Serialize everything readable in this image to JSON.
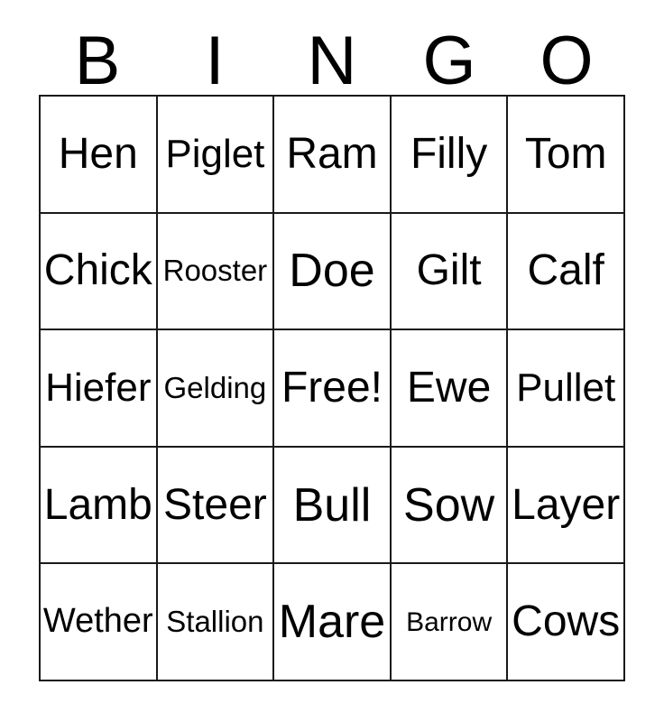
{
  "card": {
    "header_letters": [
      "B",
      "I",
      "N",
      "G",
      "O"
    ],
    "rows": [
      [
        {
          "label": "Hen",
          "size": "lg"
        },
        {
          "label": "Piglet",
          "size": "md"
        },
        {
          "label": "Ram",
          "size": "lg"
        },
        {
          "label": "Filly",
          "size": "lg"
        },
        {
          "label": "Tom",
          "size": "lg"
        }
      ],
      [
        {
          "label": "Chick",
          "size": "lg"
        },
        {
          "label": "Rooster",
          "size": "xs"
        },
        {
          "label": "Doe",
          "size": "xl"
        },
        {
          "label": "Gilt",
          "size": "lg"
        },
        {
          "label": "Calf",
          "size": "lg"
        }
      ],
      [
        {
          "label": "Hiefer",
          "size": "md"
        },
        {
          "label": "Gelding",
          "size": "xs"
        },
        {
          "label": "Free!",
          "size": "lg"
        },
        {
          "label": "Ewe",
          "size": "lg"
        },
        {
          "label": "Pullet",
          "size": "md"
        }
      ],
      [
        {
          "label": "Lamb",
          "size": "lg"
        },
        {
          "label": "Steer",
          "size": "lg"
        },
        {
          "label": "Bull",
          "size": "xl"
        },
        {
          "label": "Sow",
          "size": "xl"
        },
        {
          "label": "Layer",
          "size": "lg"
        }
      ],
      [
        {
          "label": "Wether",
          "size": "sm"
        },
        {
          "label": "Stallion",
          "size": "xs"
        },
        {
          "label": "Mare",
          "size": "xl"
        },
        {
          "label": "Barrow",
          "size": "xxs"
        },
        {
          "label": "Cows",
          "size": "lg"
        }
      ]
    ],
    "free_space": "Free!",
    "colors": {
      "text": "#000000",
      "border": "#1a1a1a",
      "background": "#ffffff"
    }
  }
}
